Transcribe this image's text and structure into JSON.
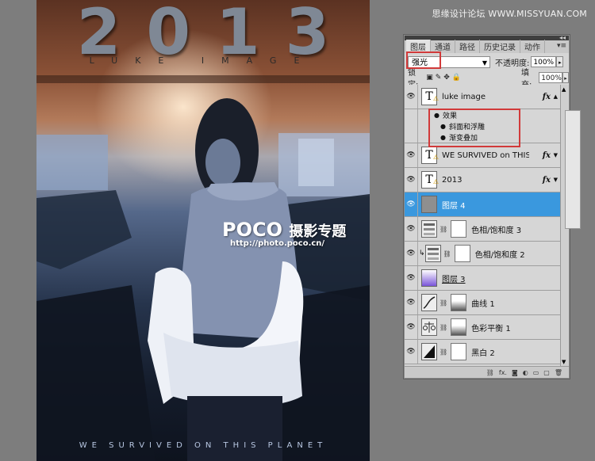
{
  "watermark": "思缘设计论坛 WWW.MISSYUAN.COM",
  "poster": {
    "title": "2013",
    "subtitle": "LUKE IMAGE",
    "tagline": "WE SURVIVED ON THIS PLANET",
    "logo_brand": "POCO",
    "logo_cn": "摄影专题",
    "logo_url": "http://photo.poco.cn/"
  },
  "panel": {
    "tabs": [
      "图层",
      "通道",
      "路径",
      "历史记录",
      "动作"
    ],
    "active_tab": "图层",
    "blend_mode": "强光",
    "opacity_label": "不透明度:",
    "opacity_value": "100%",
    "lock_label": "锁定:",
    "fill_label": "填充:",
    "fill_value": "100%",
    "layers": [
      {
        "name": "luke image",
        "thumb": "text",
        "fx": "fx",
        "visible": true
      },
      {
        "name": "WE SURVIVED on THIS PLA...",
        "thumb": "text",
        "fx": "fx",
        "visible": true
      },
      {
        "name": "2013",
        "thumb": "text",
        "fx": "fx",
        "visible": true
      },
      {
        "name": "图层 4",
        "thumb": "gray",
        "visible": true,
        "selected": true
      },
      {
        "name": "色相/饱和度 3",
        "thumb": "adj",
        "visible": true
      },
      {
        "name": "色相/饱和度 2",
        "thumb": "adj",
        "visible": true,
        "clipped": true
      },
      {
        "name": "图层 3",
        "thumb": "gradient",
        "visible": true
      },
      {
        "name": "曲线 1",
        "thumb": "curves",
        "visible": true
      },
      {
        "name": "色彩平衡 1",
        "thumb": "balance",
        "visible": true
      },
      {
        "name": "黑白 2",
        "thumb": "bw",
        "visible": true
      }
    ],
    "effects": {
      "label": "效果",
      "items": [
        "斜面和浮雕",
        "渐变叠加"
      ]
    },
    "colors": {
      "selected": "#3a98de",
      "panel_bg": "#d6d6d6",
      "highlight_box": "#d13a3a"
    }
  }
}
